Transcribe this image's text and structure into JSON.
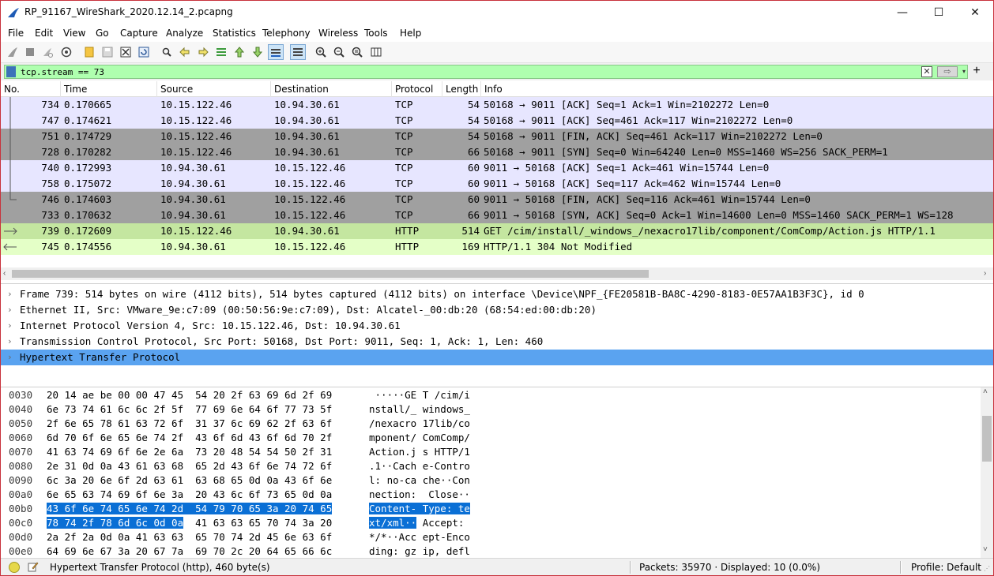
{
  "window": {
    "title": "RP_91167_WireShark_2020.12.14_2.pcapng",
    "minimize": "—",
    "maximize": "☐",
    "close": "✕"
  },
  "menu": [
    "File",
    "Edit",
    "View",
    "Go",
    "Capture",
    "Analyze",
    "Statistics",
    "Telephony",
    "Wireless",
    "Tools",
    "Help"
  ],
  "toolbar_icons": [
    "shark-fin-start-icon",
    "stop-icon",
    "restart-icon",
    "options-gear-icon",
    "open-folder-icon",
    "save-icon",
    "close-file-icon",
    "reload-icon",
    "find-icon",
    "back-arrow-icon",
    "forward-arrow-icon",
    "goto-packet-icon",
    "first-packet-icon",
    "last-packet-icon",
    "autoscroll-icon",
    "colorize-icon",
    "zoom-in-icon",
    "zoom-out-icon",
    "zoom-reset-icon",
    "resize-columns-icon"
  ],
  "filter": {
    "value": "tcp.stream == 73",
    "clear_label": "✕",
    "apply_label": "⇨",
    "dropdown_label": "▾",
    "add_label": "+"
  },
  "packet_list": {
    "columns": [
      "No.",
      "Time",
      "Source",
      "Destination",
      "Protocol",
      "Length",
      "Info"
    ],
    "rows": [
      {
        "no": "734",
        "time": "0.170665",
        "src": "10.15.122.46",
        "dst": "10.94.30.61",
        "proto": "TCP",
        "len": "54",
        "info": "50168 → 9011 [ACK] Seq=1 Ack=1 Win=2102272 Len=0",
        "style": "tcp"
      },
      {
        "no": "747",
        "time": "0.174621",
        "src": "10.15.122.46",
        "dst": "10.94.30.61",
        "proto": "TCP",
        "len": "54",
        "info": "50168 → 9011 [ACK] Seq=461 Ack=117 Win=2102272 Len=0",
        "style": "tcp"
      },
      {
        "no": "751",
        "time": "0.174729",
        "src": "10.15.122.46",
        "dst": "10.94.30.61",
        "proto": "TCP",
        "len": "54",
        "info": "50168 → 9011 [FIN, ACK] Seq=461 Ack=117 Win=2102272 Len=0",
        "style": "flag"
      },
      {
        "no": "728",
        "time": "0.170282",
        "src": "10.15.122.46",
        "dst": "10.94.30.61",
        "proto": "TCP",
        "len": "66",
        "info": "50168 → 9011 [SYN] Seq=0 Win=64240 Len=0 MSS=1460 WS=256 SACK_PERM=1",
        "style": "flag"
      },
      {
        "no": "740",
        "time": "0.172993",
        "src": "10.94.30.61",
        "dst": "10.15.122.46",
        "proto": "TCP",
        "len": "60",
        "info": "9011 → 50168 [ACK] Seq=1 Ack=461 Win=15744 Len=0",
        "style": "tcp"
      },
      {
        "no": "758",
        "time": "0.175072",
        "src": "10.94.30.61",
        "dst": "10.15.122.46",
        "proto": "TCP",
        "len": "60",
        "info": "9011 → 50168 [ACK] Seq=117 Ack=462 Win=15744 Len=0",
        "style": "tcp"
      },
      {
        "no": "746",
        "time": "0.174603",
        "src": "10.94.30.61",
        "dst": "10.15.122.46",
        "proto": "TCP",
        "len": "60",
        "info": "9011 → 50168 [FIN, ACK] Seq=116 Ack=461 Win=15744 Len=0",
        "style": "flag"
      },
      {
        "no": "733",
        "time": "0.170632",
        "src": "10.94.30.61",
        "dst": "10.15.122.46",
        "proto": "TCP",
        "len": "66",
        "info": "9011 → 50168 [SYN, ACK] Seq=0 Ack=1 Win=14600 Len=0 MSS=1460 SACK_PERM=1 WS=128",
        "style": "flag"
      },
      {
        "no": "739",
        "time": "0.172609",
        "src": "10.15.122.46",
        "dst": "10.94.30.61",
        "proto": "HTTP",
        "len": "514",
        "info": "GET /cim/install/_windows_/nexacro17lib/component/ComComp/Action.js HTTP/1.1",
        "style": "http-sel"
      },
      {
        "no": "745",
        "time": "0.174556",
        "src": "10.94.30.61",
        "dst": "10.15.122.46",
        "proto": "HTTP",
        "len": "169",
        "info": "HTTP/1.1 304 Not Modified",
        "style": "http"
      }
    ]
  },
  "details": [
    {
      "text": "Frame 739: 514 bytes on wire (4112 bits), 514 bytes captured (4112 bits) on interface \\Device\\NPF_{FE20581B-BA8C-4290-8183-0E57AA1B3F3C}, id 0",
      "selected": false
    },
    {
      "text": "Ethernet II, Src: VMware_9e:c7:09 (00:50:56:9e:c7:09), Dst: Alcatel-_00:db:20 (68:54:ed:00:db:20)",
      "selected": false
    },
    {
      "text": "Internet Protocol Version 4, Src: 10.15.122.46, Dst: 10.94.30.61",
      "selected": false
    },
    {
      "text": "Transmission Control Protocol, Src Port: 50168, Dst Port: 9011, Seq: 1, Ack: 1, Len: 460",
      "selected": false
    },
    {
      "text": "Hypertext Transfer Protocol",
      "selected": true
    }
  ],
  "detail_arrow": "›",
  "bytes": [
    {
      "off": "0030",
      "hex_a": "20 14 ae be 00 00 47 45  54 20 2f 63 69 6d 2f 69",
      "hex_hl": "",
      "hex_b": "",
      "asc_a": " ·····GE T /cim/i",
      "asc_hl": "",
      "asc_b": ""
    },
    {
      "off": "0040",
      "hex_a": "6e 73 74 61 6c 6c 2f 5f  77 69 6e 64 6f 77 73 5f",
      "hex_hl": "",
      "hex_b": "",
      "asc_a": "nstall/_ windows_",
      "asc_hl": "",
      "asc_b": ""
    },
    {
      "off": "0050",
      "hex_a": "2f 6e 65 78 61 63 72 6f  31 37 6c 69 62 2f 63 6f",
      "hex_hl": "",
      "hex_b": "",
      "asc_a": "/nexacro 17lib/co",
      "asc_hl": "",
      "asc_b": ""
    },
    {
      "off": "0060",
      "hex_a": "6d 70 6f 6e 65 6e 74 2f  43 6f 6d 43 6f 6d 70 2f",
      "hex_hl": "",
      "hex_b": "",
      "asc_a": "mponent/ ComComp/",
      "asc_hl": "",
      "asc_b": ""
    },
    {
      "off": "0070",
      "hex_a": "41 63 74 69 6f 6e 2e 6a  73 20 48 54 54 50 2f 31",
      "hex_hl": "",
      "hex_b": "",
      "asc_a": "Action.j s HTTP/1",
      "asc_hl": "",
      "asc_b": ""
    },
    {
      "off": "0080",
      "hex_a": "2e 31 0d 0a 43 61 63 68  65 2d 43 6f 6e 74 72 6f",
      "hex_hl": "",
      "hex_b": "",
      "asc_a": ".1··Cach e-Contro",
      "asc_hl": "",
      "asc_b": ""
    },
    {
      "off": "0090",
      "hex_a": "6c 3a 20 6e 6f 2d 63 61  63 68 65 0d 0a 43 6f 6e",
      "hex_hl": "",
      "hex_b": "",
      "asc_a": "l: no-ca che··Con",
      "asc_hl": "",
      "asc_b": ""
    },
    {
      "off": "00a0",
      "hex_a": "6e 65 63 74 69 6f 6e 3a  20 43 6c 6f 73 65 0d 0a",
      "hex_hl": "",
      "hex_b": "",
      "asc_a": "nection:  Close··",
      "asc_hl": "",
      "asc_b": ""
    },
    {
      "off": "00b0",
      "hex_a": "",
      "hex_hl": "43 6f 6e 74 65 6e 74 2d  54 79 70 65 3a 20 74 65",
      "hex_b": "",
      "asc_a": "",
      "asc_hl": "Content- Type: te",
      "asc_b": ""
    },
    {
      "off": "00c0",
      "hex_a": "",
      "hex_hl": "78 74 2f 78 6d 6c 0d 0a",
      "hex_b": "  41 63 63 65 70 74 3a 20",
      "asc_a": "",
      "asc_hl": "xt/xml··",
      "asc_b": " Accept:"
    },
    {
      "off": "00d0",
      "hex_a": "2a 2f 2a 0d 0a 41 63 63  65 70 74 2d 45 6e 63 6f",
      "hex_hl": "",
      "hex_b": "",
      "asc_a": "*/*··Acc ept-Enco",
      "asc_hl": "",
      "asc_b": ""
    },
    {
      "off": "00e0",
      "hex_a": "64 69 6e 67 3a 20 67 7a  69 70 2c 20 64 65 66 6c",
      "hex_hl": "",
      "hex_b": "",
      "asc_a": "ding: gz ip, defl",
      "asc_hl": "",
      "asc_b": ""
    }
  ],
  "status": {
    "message": "Hypertext Transfer Protocol (http), 460 byte(s)",
    "packets": "Packets: 35970 · Displayed: 10 (0.0%)",
    "profile": "Profile: Default"
  }
}
